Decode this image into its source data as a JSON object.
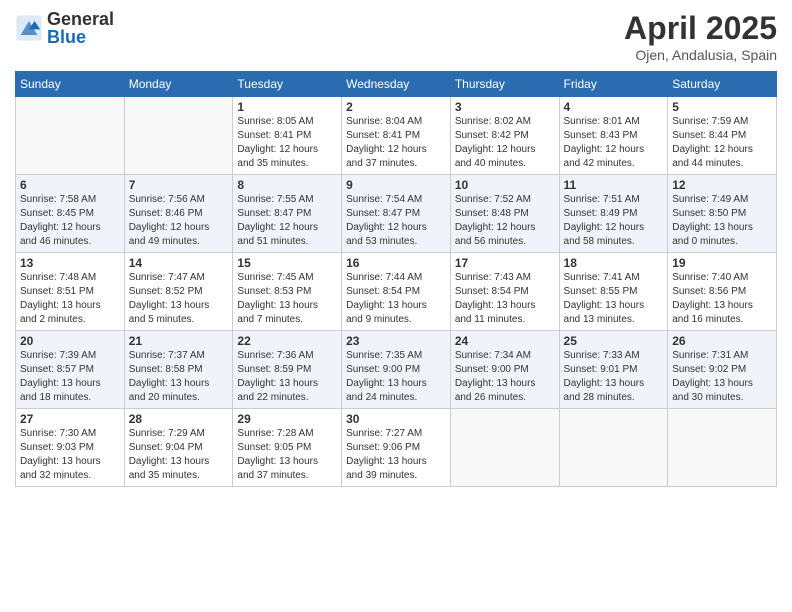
{
  "logo": {
    "general": "General",
    "blue": "Blue"
  },
  "title": "April 2025",
  "location": "Ojen, Andalusia, Spain",
  "headers": [
    "Sunday",
    "Monday",
    "Tuesday",
    "Wednesday",
    "Thursday",
    "Friday",
    "Saturday"
  ],
  "weeks": [
    [
      {
        "day": "",
        "info": ""
      },
      {
        "day": "",
        "info": ""
      },
      {
        "day": "1",
        "info": "Sunrise: 8:05 AM\nSunset: 8:41 PM\nDaylight: 12 hours and 35 minutes."
      },
      {
        "day": "2",
        "info": "Sunrise: 8:04 AM\nSunset: 8:41 PM\nDaylight: 12 hours and 37 minutes."
      },
      {
        "day": "3",
        "info": "Sunrise: 8:02 AM\nSunset: 8:42 PM\nDaylight: 12 hours and 40 minutes."
      },
      {
        "day": "4",
        "info": "Sunrise: 8:01 AM\nSunset: 8:43 PM\nDaylight: 12 hours and 42 minutes."
      },
      {
        "day": "5",
        "info": "Sunrise: 7:59 AM\nSunset: 8:44 PM\nDaylight: 12 hours and 44 minutes."
      }
    ],
    [
      {
        "day": "6",
        "info": "Sunrise: 7:58 AM\nSunset: 8:45 PM\nDaylight: 12 hours and 46 minutes."
      },
      {
        "day": "7",
        "info": "Sunrise: 7:56 AM\nSunset: 8:46 PM\nDaylight: 12 hours and 49 minutes."
      },
      {
        "day": "8",
        "info": "Sunrise: 7:55 AM\nSunset: 8:47 PM\nDaylight: 12 hours and 51 minutes."
      },
      {
        "day": "9",
        "info": "Sunrise: 7:54 AM\nSunset: 8:47 PM\nDaylight: 12 hours and 53 minutes."
      },
      {
        "day": "10",
        "info": "Sunrise: 7:52 AM\nSunset: 8:48 PM\nDaylight: 12 hours and 56 minutes."
      },
      {
        "day": "11",
        "info": "Sunrise: 7:51 AM\nSunset: 8:49 PM\nDaylight: 12 hours and 58 minutes."
      },
      {
        "day": "12",
        "info": "Sunrise: 7:49 AM\nSunset: 8:50 PM\nDaylight: 13 hours and 0 minutes."
      }
    ],
    [
      {
        "day": "13",
        "info": "Sunrise: 7:48 AM\nSunset: 8:51 PM\nDaylight: 13 hours and 2 minutes."
      },
      {
        "day": "14",
        "info": "Sunrise: 7:47 AM\nSunset: 8:52 PM\nDaylight: 13 hours and 5 minutes."
      },
      {
        "day": "15",
        "info": "Sunrise: 7:45 AM\nSunset: 8:53 PM\nDaylight: 13 hours and 7 minutes."
      },
      {
        "day": "16",
        "info": "Sunrise: 7:44 AM\nSunset: 8:54 PM\nDaylight: 13 hours and 9 minutes."
      },
      {
        "day": "17",
        "info": "Sunrise: 7:43 AM\nSunset: 8:54 PM\nDaylight: 13 hours and 11 minutes."
      },
      {
        "day": "18",
        "info": "Sunrise: 7:41 AM\nSunset: 8:55 PM\nDaylight: 13 hours and 13 minutes."
      },
      {
        "day": "19",
        "info": "Sunrise: 7:40 AM\nSunset: 8:56 PM\nDaylight: 13 hours and 16 minutes."
      }
    ],
    [
      {
        "day": "20",
        "info": "Sunrise: 7:39 AM\nSunset: 8:57 PM\nDaylight: 13 hours and 18 minutes."
      },
      {
        "day": "21",
        "info": "Sunrise: 7:37 AM\nSunset: 8:58 PM\nDaylight: 13 hours and 20 minutes."
      },
      {
        "day": "22",
        "info": "Sunrise: 7:36 AM\nSunset: 8:59 PM\nDaylight: 13 hours and 22 minutes."
      },
      {
        "day": "23",
        "info": "Sunrise: 7:35 AM\nSunset: 9:00 PM\nDaylight: 13 hours and 24 minutes."
      },
      {
        "day": "24",
        "info": "Sunrise: 7:34 AM\nSunset: 9:00 PM\nDaylight: 13 hours and 26 minutes."
      },
      {
        "day": "25",
        "info": "Sunrise: 7:33 AM\nSunset: 9:01 PM\nDaylight: 13 hours and 28 minutes."
      },
      {
        "day": "26",
        "info": "Sunrise: 7:31 AM\nSunset: 9:02 PM\nDaylight: 13 hours and 30 minutes."
      }
    ],
    [
      {
        "day": "27",
        "info": "Sunrise: 7:30 AM\nSunset: 9:03 PM\nDaylight: 13 hours and 32 minutes."
      },
      {
        "day": "28",
        "info": "Sunrise: 7:29 AM\nSunset: 9:04 PM\nDaylight: 13 hours and 35 minutes."
      },
      {
        "day": "29",
        "info": "Sunrise: 7:28 AM\nSunset: 9:05 PM\nDaylight: 13 hours and 37 minutes."
      },
      {
        "day": "30",
        "info": "Sunrise: 7:27 AM\nSunset: 9:06 PM\nDaylight: 13 hours and 39 minutes."
      },
      {
        "day": "",
        "info": ""
      },
      {
        "day": "",
        "info": ""
      },
      {
        "day": "",
        "info": ""
      }
    ]
  ]
}
